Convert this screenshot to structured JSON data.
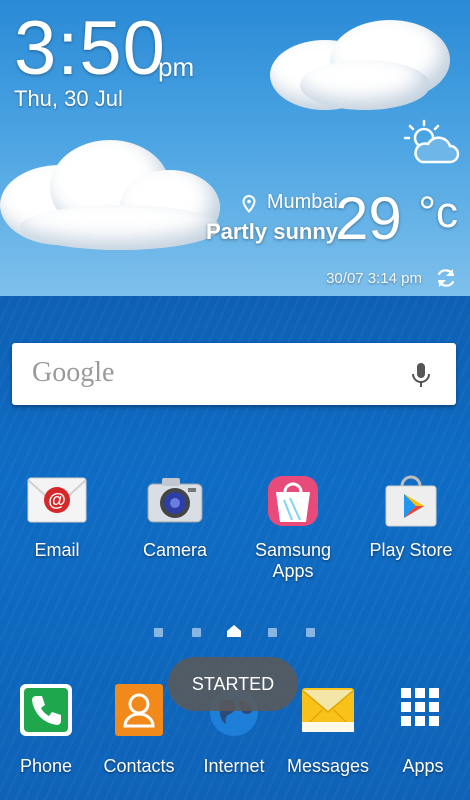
{
  "clock": {
    "time": "3:50",
    "ampm": "pm",
    "date": "Thu, 30 Jul"
  },
  "weather": {
    "location": "Mumbai",
    "condition": "Partly sunny",
    "temperature": "29",
    "unit": "°c",
    "updated": "30/07 3:14 pm",
    "icon": "partly-sunny-icon"
  },
  "search": {
    "logo": "Google",
    "mic_icon": "microphone-icon"
  },
  "apps": [
    {
      "label": "Email",
      "icon": "email-icon"
    },
    {
      "label": "Camera",
      "icon": "camera-icon"
    },
    {
      "label": "Samsung\nApps",
      "icon": "samsung-apps-icon"
    },
    {
      "label": "Play Store",
      "icon": "play-store-icon"
    }
  ],
  "page_indicator": {
    "pages": 5,
    "current": 3
  },
  "dock": [
    {
      "label": "Phone",
      "icon": "phone-icon"
    },
    {
      "label": "Contacts",
      "icon": "contacts-icon"
    },
    {
      "label": "Internet",
      "icon": "globe-icon"
    },
    {
      "label": "Messages",
      "icon": "messages-icon"
    },
    {
      "label": "Apps",
      "icon": "apps-grid-icon"
    }
  ],
  "toast": {
    "text": "STARTED"
  }
}
